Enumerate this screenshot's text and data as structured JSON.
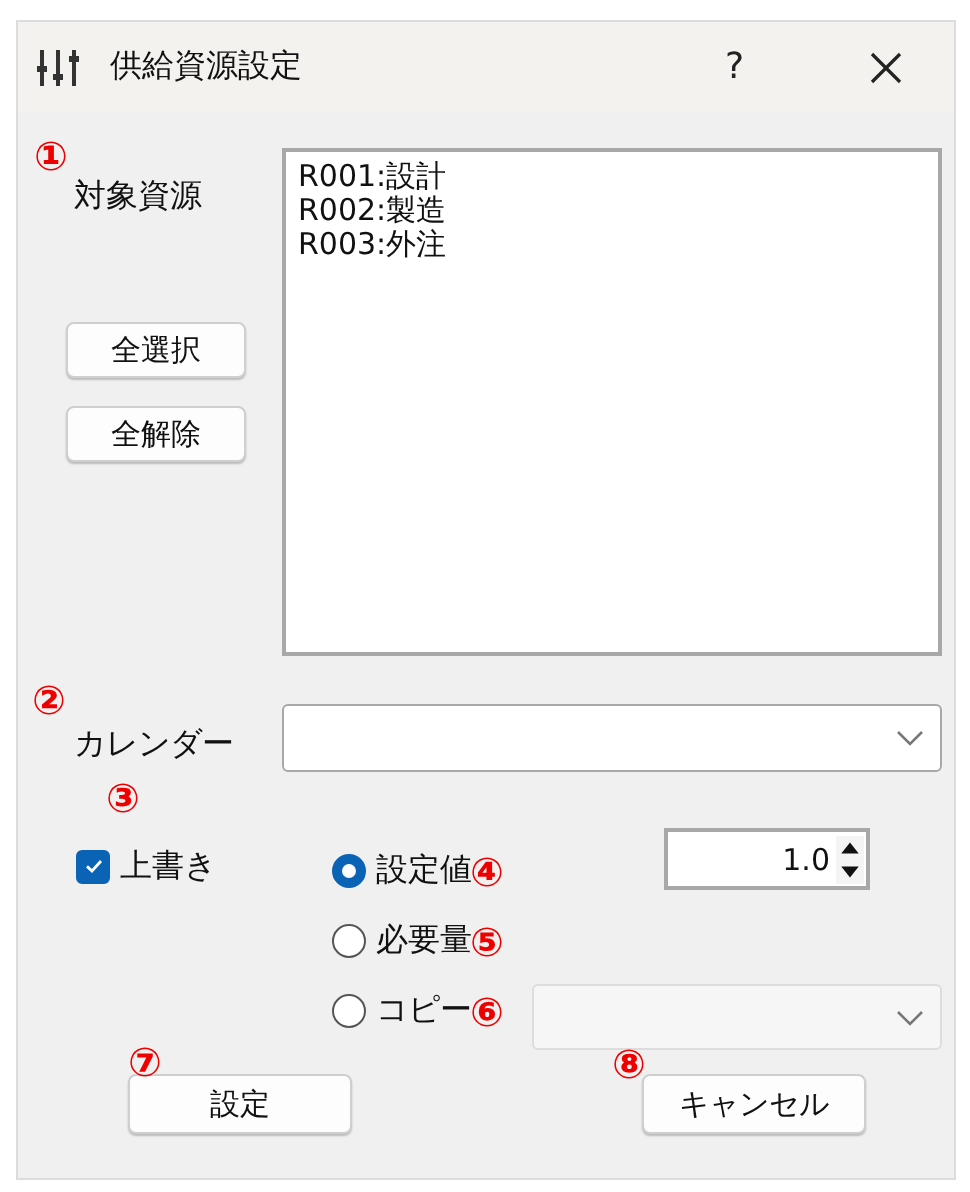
{
  "window": {
    "title": "供給資源設定",
    "help": "?"
  },
  "resources": {
    "label": "対象資源",
    "marker": "①",
    "select_all": "全選択",
    "deselect_all": "全解除",
    "items": [
      {
        "text": "R001:設計",
        "selected": false
      },
      {
        "text": "R002:製造",
        "selected": false
      },
      {
        "text": "R003:外注",
        "selected": false
      }
    ]
  },
  "calendar": {
    "label": "カレンダー",
    "marker": "②"
  },
  "overwrite": {
    "label": "上書き",
    "checked": true,
    "marker": "③"
  },
  "modes": [
    {
      "label": "設定値",
      "selected": true,
      "marker": "④"
    },
    {
      "label": "必要量",
      "selected": false,
      "marker": "⑤"
    },
    {
      "label": "コピー",
      "selected": false,
      "marker": "⑥"
    }
  ],
  "spin": {
    "value": "1.0"
  },
  "copy_source": {
    "disabled": true
  },
  "buttons": [
    {
      "label": "設定",
      "marker": "⑦"
    },
    {
      "label": "キャンセル",
      "marker": "⑧"
    }
  ]
}
